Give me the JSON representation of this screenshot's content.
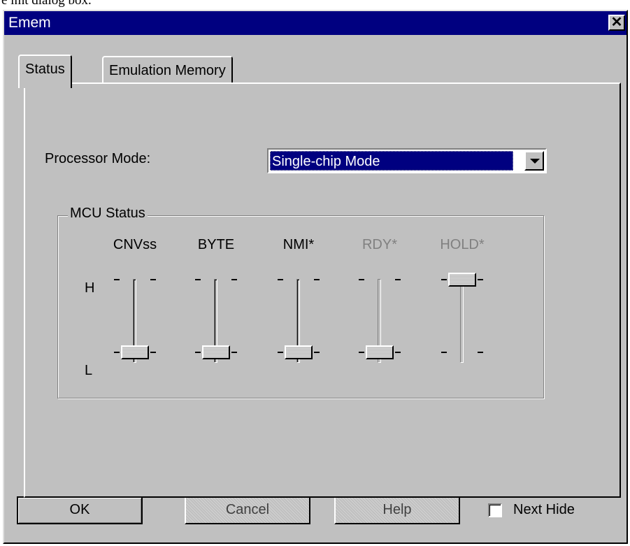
{
  "caption": "e lmt dialog box.",
  "window": {
    "title": "Emem",
    "close_glyph": "✕"
  },
  "tabs": [
    {
      "label": "Status",
      "active": true
    },
    {
      "label": "Emulation Memory",
      "active": false
    }
  ],
  "processor_mode": {
    "label": "Processor Mode:",
    "selected": "Single-chip Mode"
  },
  "mcu_status": {
    "title": "MCU Status",
    "h_label": "H",
    "l_label": "L",
    "tick": "-",
    "signals": [
      {
        "name": "CNVss",
        "level": "L",
        "enabled": true
      },
      {
        "name": "BYTE",
        "level": "L",
        "enabled": true
      },
      {
        "name": "NMI*",
        "level": "L",
        "enabled": true
      },
      {
        "name": "RDY*",
        "level": "L",
        "enabled": false
      },
      {
        "name": "HOLD*",
        "level": "H",
        "enabled": false
      }
    ]
  },
  "buttons": {
    "ok": "OK",
    "cancel": "Cancel",
    "help": "Help"
  },
  "next_hide": {
    "label": "Next Hide",
    "checked": false
  },
  "colors": {
    "face": "#c0c0c0",
    "title_bar": "#000080",
    "selection": "#000080",
    "disabled_text": "#808080"
  }
}
